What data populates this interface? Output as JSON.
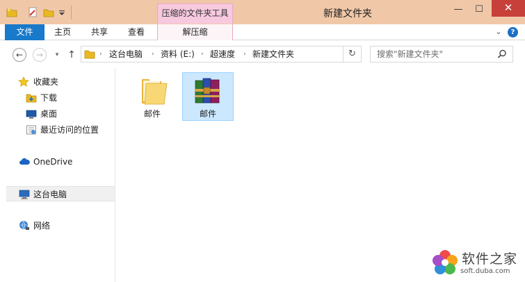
{
  "window": {
    "title": "新建文件夹",
    "context_tab_header": "压缩的文件夹工具",
    "minimize_glyph": "—",
    "maximize_glyph": "☐",
    "close_glyph": "✕"
  },
  "quick_access": {
    "icons": [
      "folder-icon",
      "properties-icon",
      "new-folder-icon",
      "customize-dropdown-icon"
    ]
  },
  "ribbon": {
    "file_tab": "文件",
    "tabs": [
      "主页",
      "共享",
      "查看"
    ],
    "context_tab": "解压缩",
    "expand_glyph": "⌄",
    "help_glyph": "?"
  },
  "navigation": {
    "back_glyph": "←",
    "forward_glyph": "→",
    "recent_glyph": "▾",
    "up_glyph": "↑",
    "refresh_glyph": "↻",
    "address_dropdown_glyph": "▾",
    "breadcrumb_separator": "›",
    "breadcrumb": [
      "这台电脑",
      "资料 (E:)",
      "超速度",
      "新建文件夹"
    ],
    "search_placeholder": "搜索\"新建文件夹\""
  },
  "sidebar": {
    "favorites": "收藏夹",
    "favorites_items": [
      "下载",
      "桌面",
      "最近访问的位置"
    ],
    "onedrive": "OneDrive",
    "this_pc": "这台电脑",
    "network": "网络"
  },
  "files": [
    {
      "name": "邮件",
      "type": "folder",
      "selected": false
    },
    {
      "name": "邮件",
      "type": "zip-archive",
      "selected": true
    }
  ],
  "watermark": {
    "name": "软件之家",
    "url": "soft.duba.com"
  },
  "colors": {
    "title_bar": "#f0c8a8",
    "file_tab": "#1979ca",
    "context_tab": "#f7c9df",
    "close_button": "#c7403a",
    "selection": "#cce8ff"
  }
}
